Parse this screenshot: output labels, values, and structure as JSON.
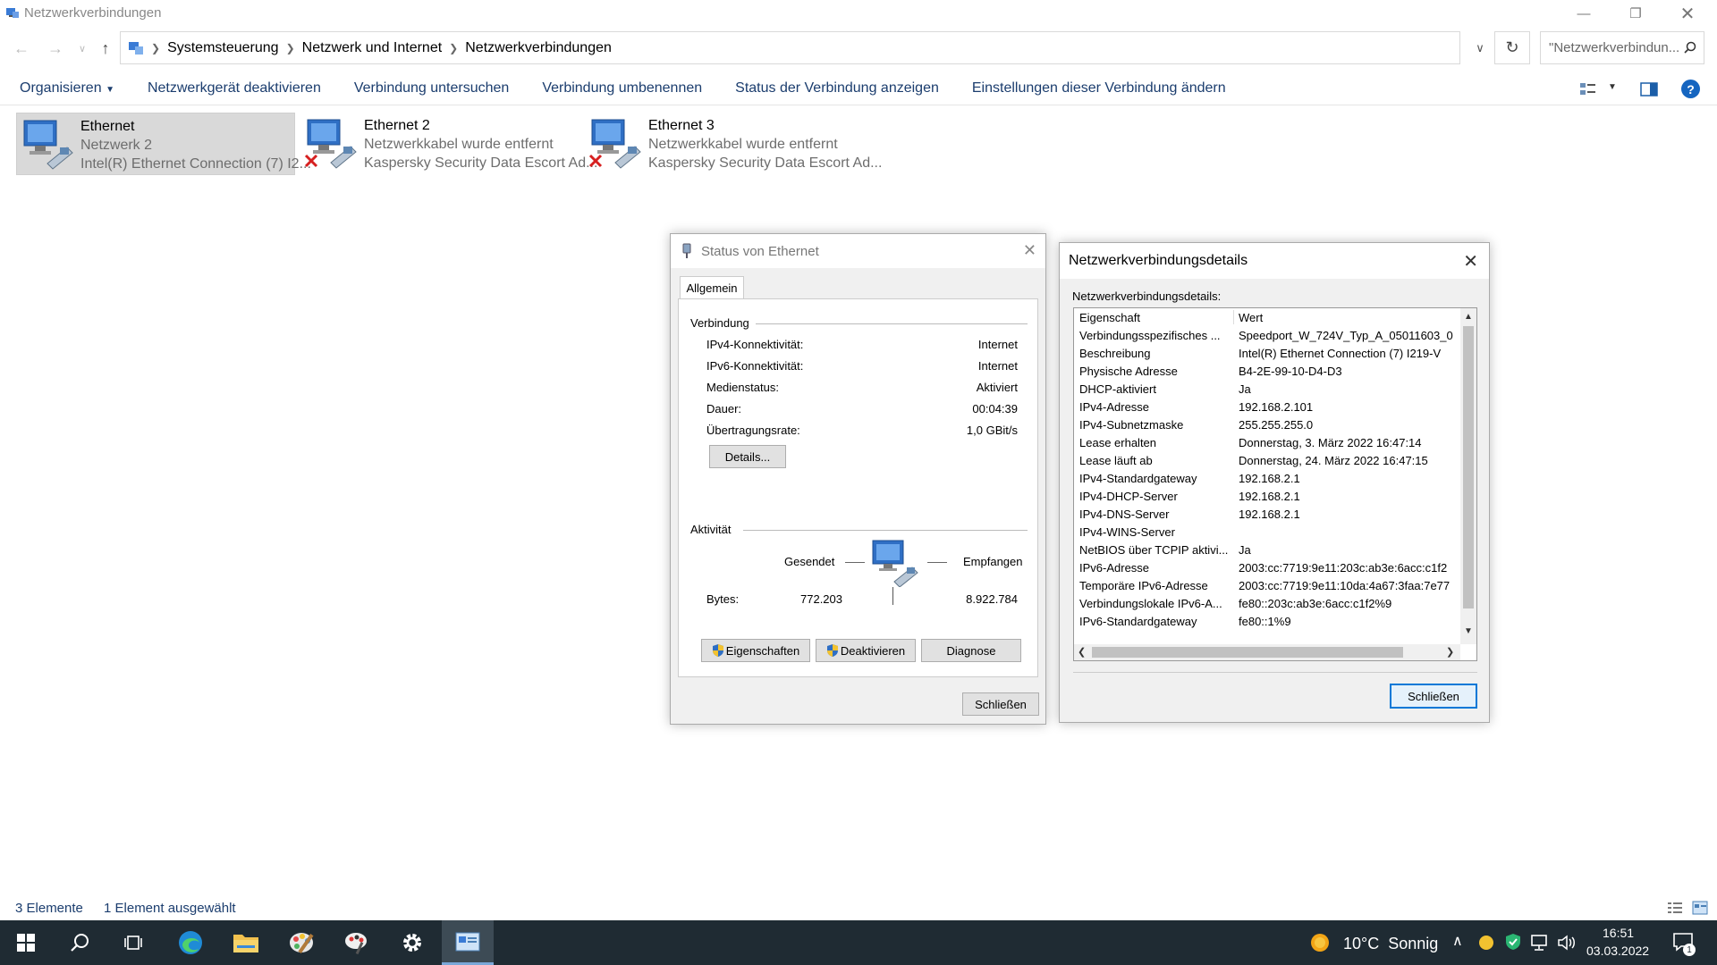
{
  "window": {
    "title": "Netzwerkverbindungen"
  },
  "address": {
    "crumbs": [
      "Systemsteuerung",
      "Netzwerk und Internet",
      "Netzwerkverbindungen"
    ],
    "search_placeholder": "\"Netzwerkverbindun..."
  },
  "commands": [
    "Organisieren",
    "Netzwerkgerät deaktivieren",
    "Verbindung untersuchen",
    "Verbindung umbenennen",
    "Status der Verbindung anzeigen",
    "Einstellungen dieser Verbindung ändern"
  ],
  "connections": [
    {
      "name": "Ethernet",
      "line1": "Netzwerk 2",
      "line2": "Intel(R) Ethernet Connection (7) I2...",
      "selected": true,
      "error": false
    },
    {
      "name": "Ethernet 2",
      "line1": "Netzwerkkabel wurde entfernt",
      "line2": "Kaspersky Security Data Escort Ad...",
      "selected": false,
      "error": true
    },
    {
      "name": "Ethernet 3",
      "line1": "Netzwerkkabel wurde entfernt",
      "line2": "Kaspersky Security Data Escort Ad...",
      "selected": false,
      "error": true
    }
  ],
  "status_dialog": {
    "title": "Status von Ethernet",
    "tab": "Allgemein",
    "connection_header": "Verbindung",
    "rows": [
      {
        "label": "IPv4-Konnektivität:",
        "value": "Internet"
      },
      {
        "label": "IPv6-Konnektivität:",
        "value": "Internet"
      },
      {
        "label": "Medienstatus:",
        "value": "Aktiviert"
      },
      {
        "label": "Dauer:",
        "value": "00:04:39"
      },
      {
        "label": "Übertragungsrate:",
        "value": "1,0 GBit/s"
      }
    ],
    "details_button": "Details...",
    "activity_header": "Aktivität",
    "sent_label": "Gesendet",
    "received_label": "Empfangen",
    "bytes_label": "Bytes:",
    "bytes_sent": "772.203",
    "bytes_received": "8.922.784",
    "btn_properties": "Eigenschaften",
    "btn_disable": "Deaktivieren",
    "btn_diagnose": "Diagnose",
    "btn_close": "Schließen"
  },
  "details_dialog": {
    "title": "Netzwerkverbindungsdetails",
    "list_label": "Netzwerkverbindungsdetails:",
    "col_property": "Eigenschaft",
    "col_value": "Wert",
    "rows": [
      {
        "p": "Verbindungsspezifisches ...",
        "v": "Speedport_W_724V_Typ_A_05011603_0"
      },
      {
        "p": "Beschreibung",
        "v": "Intel(R) Ethernet Connection (7) I219-V"
      },
      {
        "p": "Physische Adresse",
        "v": "B4-2E-99-10-D4-D3"
      },
      {
        "p": "DHCP-aktiviert",
        "v": "Ja"
      },
      {
        "p": "IPv4-Adresse",
        "v": "192.168.2.101"
      },
      {
        "p": "IPv4-Subnetzmaske",
        "v": "255.255.255.0"
      },
      {
        "p": "Lease erhalten",
        "v": "Donnerstag, 3. März 2022 16:47:14"
      },
      {
        "p": "Lease läuft ab",
        "v": "Donnerstag, 24. März 2022 16:47:15"
      },
      {
        "p": "IPv4-Standardgateway",
        "v": "192.168.2.1"
      },
      {
        "p": "IPv4-DHCP-Server",
        "v": "192.168.2.1"
      },
      {
        "p": "IPv4-DNS-Server",
        "v": "192.168.2.1"
      },
      {
        "p": "IPv4-WINS-Server",
        "v": ""
      },
      {
        "p": "NetBIOS über TCPIP aktivi...",
        "v": "Ja"
      },
      {
        "p": "IPv6-Adresse",
        "v": "2003:cc:7719:9e11:203c:ab3e:6acc:c1f2"
      },
      {
        "p": "Temporäre IPv6-Adresse",
        "v": "2003:cc:7719:9e11:10da:4a67:3faa:7e77"
      },
      {
        "p": "Verbindungslokale IPv6-A...",
        "v": "fe80::203c:ab3e:6acc:c1f2%9"
      },
      {
        "p": "IPv6-Standardgateway",
        "v": "fe80::1%9"
      }
    ],
    "btn_close": "Schließen"
  },
  "statusbar": {
    "count": "3 Elemente",
    "selected": "1 Element ausgewählt"
  },
  "taskbar": {
    "weather": "10°C  Sonnig",
    "time": "16:51",
    "date": "03.03.2022",
    "notification_count": "1"
  }
}
